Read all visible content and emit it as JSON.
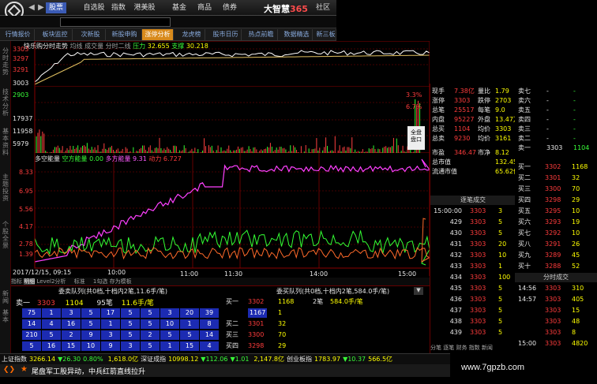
{
  "app": {
    "brand": "大智慧",
    "brand_num": "365",
    "menu": [
      "股票",
      "自选股",
      "指数",
      "港美股",
      "基金",
      "商品",
      "债券",
      "社区"
    ],
    "tabs": [
      "行情报价",
      "板块监控",
      "次新股",
      "新股申购",
      "涨停分析",
      "龙虎榜",
      "股市日历",
      "热点前瞻",
      "数据精选",
      "新三板"
    ]
  },
  "chart": {
    "title": "快乐购分时走势",
    "legend": [
      "均线",
      "成交量",
      "分时二线",
      "压力"
    ],
    "legend_vals": [
      "32.655",
      "30.218"
    ],
    "legend_tag": "支撑",
    "y_labels": [
      "3303",
      "3297",
      "3291",
      "3003"
    ],
    "pct_labels": [
      "3.3%",
      "6.7%"
    ],
    "vol_labels": [
      "2903",
      "17937",
      "11958",
      "5979"
    ],
    "energy_title": "多空能量",
    "energy_legend": [
      "空方能量",
      "0.00",
      "多方能量",
      "9.31",
      "动力",
      "6.727"
    ],
    "energy_y": [
      "8.33",
      "6.95",
      "5.56",
      "4.17",
      "2.78",
      "1.39"
    ],
    "x_labels": [
      "2017/12/15, 09:15",
      "10:00",
      "11:00",
      "11:30",
      "14:00",
      "15:00"
    ],
    "side_btn": "全盘\n盘口"
  },
  "left_strip": {
    "labels": [
      "分时走势",
      "技术分析",
      "基本资料",
      "主题投资",
      "个股全景",
      "新闻",
      "基本"
    ]
  },
  "bottom_tabs": [
    "指标",
    "明细",
    "Level2分析",
    "标准",
    "1勾选",
    "存为模板"
  ],
  "queue": {
    "sell_title": "委卖队列(共0档,十档内2笔,11.6手/笔)",
    "buy_title": "委买队列(共0档,十档内2笔,584.0手/笔)",
    "sell_head": {
      "label": "卖一",
      "price": "3303",
      "vol": "1104",
      "count": "95笔",
      "avg": "11.6手/笔"
    },
    "buy_head": {
      "label": "买一",
      "price": "3302",
      "vol": "1168",
      "count": "2笔",
      "avg": "584.0手/笔"
    },
    "sell_rows": [
      [
        "75",
        "1",
        "3",
        "5",
        "17",
        "5",
        "5",
        "3",
        "20",
        "39"
      ],
      [
        "14",
        "4",
        "16",
        "5",
        "1",
        "5",
        "5",
        "10",
        "1",
        "8"
      ],
      [
        "210",
        "5",
        "2",
        "9",
        "3",
        "5",
        "2",
        "5",
        "5",
        "14"
      ],
      [
        "5",
        "16",
        "15",
        "10",
        "9",
        "3",
        "5",
        "1",
        "15",
        "4"
      ]
    ],
    "buy_rows": [
      {
        "label": "买一",
        "price": "3302",
        "vol": "1168"
      },
      {
        "label": "",
        "price": "1167",
        "vol": "1"
      },
      {
        "label": "买二",
        "price": "3301",
        "vol": "32"
      },
      {
        "label": "买三",
        "price": "3300",
        "vol": "70"
      },
      {
        "label": "买四",
        "price": "3298",
        "vol": "29"
      }
    ]
  },
  "quote": {
    "rows": [
      {
        "l": "现手",
        "v": "7.38亿",
        "l2": "量比",
        "v2": "1.79"
      },
      {
        "l": "涨停",
        "v": "3303",
        "l2": "跌停",
        "v2": "2703"
      },
      {
        "l": "总笔",
        "v": "25517",
        "l2": "每笔",
        "v2": "9.0"
      },
      {
        "l": "内盘",
        "v": "95227",
        "l2": "外盘",
        "v2": "13.47万"
      },
      {
        "l": "总买",
        "v": "1104",
        "l2": "均价",
        "v2": "3303"
      },
      {
        "l": "总卖",
        "v": "9230",
        "l2": "均价",
        "v2": "3161"
      },
      {
        "l": "市盈",
        "v": "346.47",
        "l2": "市净",
        "v2": "8.12"
      },
      {
        "l": "总市值",
        "v": "",
        "l2": "",
        "v2": "132.45亿"
      },
      {
        "l": "流通市值",
        "v": "",
        "l2": "",
        "v2": "65.62亿"
      }
    ],
    "trades_title": "逐笔成交",
    "trades": [
      {
        "t": "15:00:00",
        "p": "3303",
        "v": "3"
      },
      {
        "t": "429",
        "p": "3303",
        "v": "5"
      },
      {
        "t": "430",
        "p": "3303",
        "v": "5"
      },
      {
        "t": "431",
        "p": "3303",
        "v": "20"
      },
      {
        "t": "432",
        "p": "3303",
        "v": "10"
      },
      {
        "t": "433",
        "p": "3303",
        "v": "1"
      },
      {
        "t": "434",
        "p": "3303",
        "v": "100"
      },
      {
        "t": "435",
        "p": "3303",
        "v": "5"
      },
      {
        "t": "436",
        "p": "3303",
        "v": "5"
      },
      {
        "t": "437",
        "p": "3303",
        "v": "5"
      },
      {
        "t": "438",
        "p": "3303",
        "v": "5"
      },
      {
        "t": "439",
        "p": "3303",
        "v": "5"
      }
    ],
    "footer": "分笔 逐笔 财务 指数 新闻"
  },
  "orders": {
    "top": [
      {
        "l": "卖七",
        "v": ""
      },
      {
        "l": "卖六",
        "v": ""
      },
      {
        "l": "卖五",
        "v": ""
      },
      {
        "l": "卖四",
        "v": ""
      },
      {
        "l": "卖三",
        "v": ""
      },
      {
        "l": "卖二",
        "v": ""
      },
      {
        "l": "卖一",
        "v": "1104"
      }
    ],
    "sell1_price": "3303",
    "buy": [
      {
        "l": "买一",
        "p": "3302",
        "v": "1168"
      },
      {
        "l": "买二",
        "p": "3301",
        "v": "32"
      },
      {
        "l": "买三",
        "p": "3300",
        "v": "70"
      },
      {
        "l": "买四",
        "p": "3298",
        "v": "29"
      },
      {
        "l": "买五",
        "p": "3295",
        "v": "10"
      },
      {
        "l": "买六",
        "p": "3293",
        "v": "19"
      },
      {
        "l": "买七",
        "p": "3292",
        "v": "10"
      },
      {
        "l": "买八",
        "p": "3291",
        "v": "26"
      },
      {
        "l": "买九",
        "p": "3289",
        "v": "45"
      },
      {
        "l": "买十",
        "p": "3288",
        "v": "52"
      }
    ],
    "fenshi_title": "分时成交",
    "fenshi": [
      {
        "t": "14:56",
        "p": "3303",
        "v": "310"
      },
      {
        "t": "14:57",
        "p": "3303",
        "v": "405"
      },
      {
        "t": "",
        "p": "3303",
        "v": "15"
      },
      {
        "t": "",
        "p": "3303",
        "v": "48"
      },
      {
        "t": "",
        "p": "3303",
        "v": "8"
      },
      {
        "t": "15:00",
        "p": "3303",
        "v": "4820"
      }
    ]
  },
  "status": {
    "items": [
      {
        "n": "上证指数",
        "v": "3266.14",
        "c": "▼26.30",
        "p": "0.80%"
      },
      {
        "n": "",
        "v": "1,618.0亿",
        "c": "",
        "p": ""
      },
      {
        "n": "深证成指",
        "v": "10998.12",
        "c": "▼112.06",
        "p": "▼1.01"
      },
      {
        "n": "",
        "v": "2,147.8亿",
        "c": "",
        "p": ""
      },
      {
        "n": "创业板指",
        "v": "1783.97",
        "c": "▼10.37",
        "p": ""
      },
      {
        "n": "",
        "v": "566.5亿",
        "c": "",
        "p": ""
      }
    ]
  },
  "marquee": "尾盘军工股异动，中兵红箭直线拉升",
  "watermark": "www.7gpzb.com"
}
